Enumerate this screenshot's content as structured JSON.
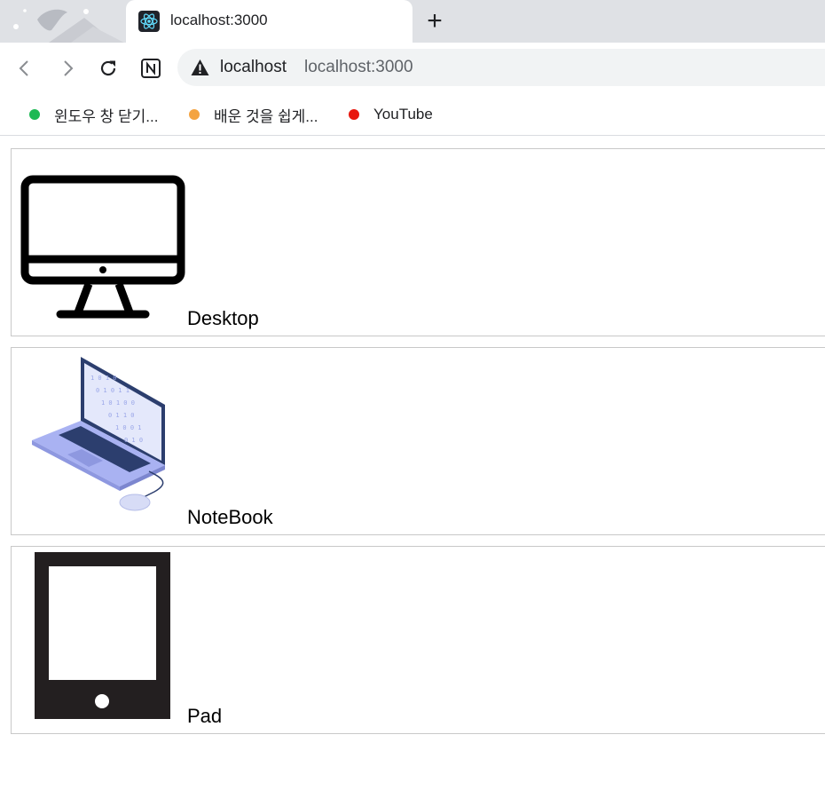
{
  "browser": {
    "tab": {
      "title": "localhost:3000",
      "favicon": "react-icon"
    },
    "new_tab_icon": "+",
    "toolbar": {
      "back": "back-arrow-icon",
      "forward": "forward-arrow-icon",
      "reload": "reload-icon",
      "extension": "notion-icon"
    },
    "address": {
      "host": "localhost",
      "url": "localhost:3000",
      "security_icon": "warning-icon"
    }
  },
  "bookmarks": [
    {
      "label": "윈도우 창 닫기...",
      "color": "#1db954"
    },
    {
      "label": "배운 것을 쉽게...",
      "color": "#f4a340"
    },
    {
      "label": "YouTube",
      "color": "#e8170d"
    }
  ],
  "products": [
    {
      "label": "Desktop",
      "icon": "desktop-monitor-icon"
    },
    {
      "label": "NoteBook",
      "icon": "laptop-icon"
    },
    {
      "label": "Pad",
      "icon": "tablet-icon"
    }
  ]
}
